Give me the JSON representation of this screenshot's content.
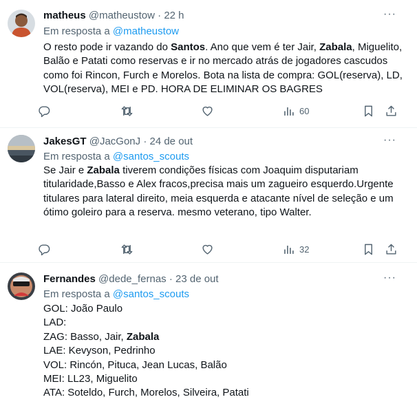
{
  "tweets": [
    {
      "name": "matheus",
      "handle": "@matheustow",
      "separator": "·",
      "time": "22 h",
      "reply_prefix": "Em resposta a ",
      "reply_to": "@matheustow",
      "segments": [
        {
          "t": "O resto pode ir vazando do ",
          "b": false
        },
        {
          "t": "Santos",
          "b": true
        },
        {
          "t": ". Ano que vem é ter Jair, ",
          "b": false
        },
        {
          "t": "Zabala",
          "b": true
        },
        {
          "t": ", Miguelito, Balão e Patati como reservas e ir no mercado atrás de jogadores cascudos como foi Rincon, Furch e Morelos. Bota na lista de compra: GOL(reserva), LD, VOL(reserva), MEI e PD. HORA DE ELIMINAR OS BAGRES",
          "b": false
        }
      ],
      "views": "60"
    },
    {
      "name": "JakesGT",
      "handle": "@JacGonJ",
      "separator": "·",
      "time": "24 de out",
      "reply_prefix": "Em resposta a ",
      "reply_to": "@santos_scouts",
      "segments": [
        {
          "t": "Se Jair e ",
          "b": false
        },
        {
          "t": "Zabala",
          "b": true
        },
        {
          "t": " tiverem condições físicas com Joaquim disputariam titularidade,Basso e Alex fracos,precisa mais um zagueiro esquerdo.Urgente titulares para lateral direito, meia esquerda e atacante nível de seleção e um ótimo goleiro para a reserva. mesmo veterano, tipo Walter.",
          "b": false
        }
      ],
      "views": "32"
    },
    {
      "name": "Fernandes",
      "handle": "@dede_fernas",
      "separator": "·",
      "time": "23 de out",
      "reply_prefix": "Em resposta a ",
      "reply_to": "@santos_scouts",
      "lines": [
        [
          {
            "t": "GOL: João Paulo",
            "b": false
          }
        ],
        [
          {
            "t": "LAD:",
            "b": false
          }
        ],
        [
          {
            "t": "ZAG: Basso, Jair, ",
            "b": false
          },
          {
            "t": "Zabala",
            "b": true
          }
        ],
        [
          {
            "t": "LAE: Kevyson, Pedrinho",
            "b": false
          }
        ],
        [
          {
            "t": "VOL: Rincón, Pituca, Jean Lucas, Balão",
            "b": false
          }
        ],
        [
          {
            "t": "MEI: LL23, Miguelito",
            "b": false
          }
        ],
        [
          {
            "t": "ATA: Soteldo, Furch, Morelos, Silveira, Patati",
            "b": false
          }
        ]
      ]
    }
  ],
  "icons": {
    "reply": "reply-icon",
    "retweet": "retweet-icon",
    "like": "like-icon",
    "views": "views-icon",
    "bookmark": "bookmark-icon",
    "share": "share-icon",
    "more": "more-icon"
  },
  "more_glyph": "···",
  "colors": {
    "link": "#1d9bf0",
    "secondary": "#536471",
    "text": "#0f1419",
    "divider": "#eff3f4"
  }
}
